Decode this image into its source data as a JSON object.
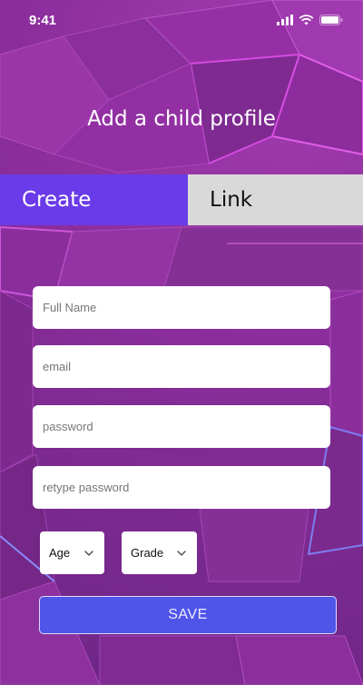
{
  "status_bar": {
    "time": "9:41"
  },
  "header": {
    "title": "Add a child profile"
  },
  "tabs": [
    {
      "label": "Create",
      "active": true
    },
    {
      "label": "Link",
      "active": false
    }
  ],
  "form": {
    "full_name": {
      "placeholder": "Full Name",
      "value": ""
    },
    "email": {
      "placeholder": "email",
      "value": ""
    },
    "password": {
      "placeholder": "password",
      "value": ""
    },
    "retype_password": {
      "placeholder": "retype password",
      "value": ""
    },
    "age": {
      "label": "Age"
    },
    "grade": {
      "label": "Grade"
    },
    "save_label": "SAVE"
  },
  "colors": {
    "tab_active": "#6a3be8",
    "tab_inactive": "#d9d9d9",
    "save_button": "#4f55e9",
    "background": "#8e2f9e"
  }
}
